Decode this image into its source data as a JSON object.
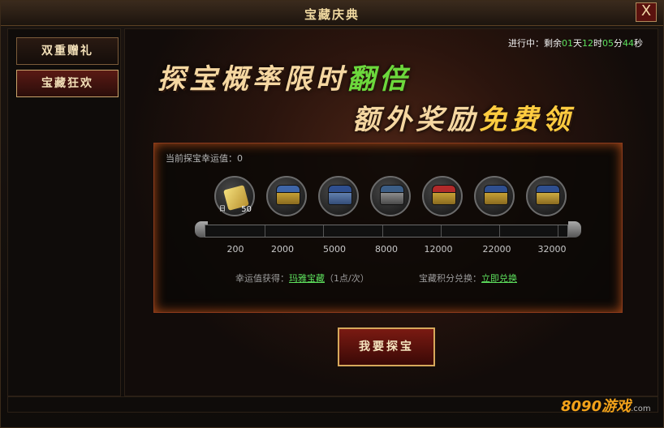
{
  "window": {
    "title": "宝藏庆典",
    "close": "X"
  },
  "sidebar": {
    "items": [
      {
        "label": "双重赠礼",
        "active": false
      },
      {
        "label": "宝藏狂欢",
        "active": true
      }
    ]
  },
  "timer": {
    "prefix": "进行中：剩余",
    "days": "01",
    "day_unit": "天",
    "hours": "12",
    "hour_unit": "时",
    "minutes": "05",
    "minute_unit": "分",
    "seconds": "44",
    "second_unit": "秒"
  },
  "banner": {
    "line1_prefix": "探宝概率限时",
    "line1_emph": "翻倍",
    "line2_prefix": "额外奖励",
    "line2_emph": "免费领"
  },
  "panel": {
    "luck_label": "当前探宝幸运值：0",
    "reward_first_qty": "50",
    "reward_first_tag": "日",
    "thresholds": [
      "200",
      "2000",
      "5000",
      "8000",
      "12000",
      "22000",
      "32000"
    ],
    "gain_label": "幸运值获得：",
    "gain_link": "玛雅宝藏",
    "gain_rate": "（1点/次）",
    "exchange_label": "宝藏积分兑换：",
    "exchange_link": "立即兑换"
  },
  "action": {
    "button": "我要探宝"
  },
  "watermark": {
    "brand": "8090游戏",
    "site": ".com"
  }
}
